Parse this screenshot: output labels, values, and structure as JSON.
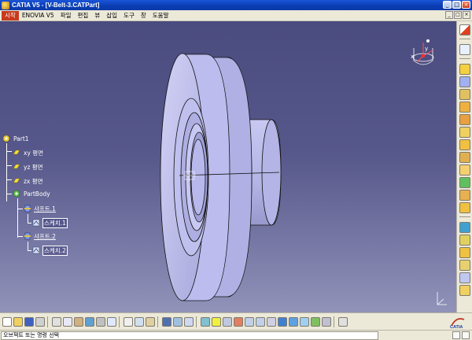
{
  "window": {
    "title": "CATIA V5 - [V-Belt-3.CATPart]",
    "buttons": {
      "minimize": "_",
      "maximize": "□",
      "close": "×"
    }
  },
  "menu": {
    "items": [
      "시작",
      "ENOVIA V5",
      "파일",
      "편집",
      "뷰",
      "삽입",
      "도구",
      "창",
      "도움말"
    ],
    "active": "시작",
    "mdi_buttons": [
      "_",
      "□",
      "×"
    ]
  },
  "tree": {
    "root": "Part1",
    "planes": [
      "xy 평면",
      "yz 평면",
      "zx 평면"
    ],
    "body": "PartBody",
    "features": [
      {
        "label": "샤프트.1",
        "child": "스케치.1"
      },
      {
        "label": "샤프트.2",
        "child": "스케치.2"
      }
    ]
  },
  "compass": {
    "axis_labels": {
      "x": "x",
      "y": "y"
    }
  },
  "status": {
    "prompt": "오브젝트 또는 명령 선택"
  },
  "colors": {
    "viewport_top": "#4a4b7e",
    "viewport_bottom": "#9293b9",
    "part_fill": "#b8b8ea",
    "menu_active": "#c83a1e",
    "titlebar": "#0a3cb2"
  },
  "icons": {
    "right_toolbar": [
      "select-arrow-icon",
      "sketcher-icon",
      "pad-icon",
      "shaft-icon",
      "hole-icon",
      "pocket-icon",
      "groove-icon",
      "fillet-icon",
      "chamfer-icon",
      "draft-icon",
      "shell-icon",
      "thickness-icon",
      "thread-icon",
      "mirror-icon",
      "pattern-icon",
      "scaling-icon",
      "split-icon",
      "sew-icon",
      "close-surface-icon",
      "measure-icon"
    ],
    "bottom_toolbar": [
      "new-icon",
      "open-icon",
      "save-icon",
      "print-icon",
      "cut-icon",
      "copy-icon",
      "paste-icon",
      "undo-icon",
      "redo-icon",
      "help-icon",
      "formula-icon",
      "knowledge-icon",
      "catalog-icon",
      "table-icon",
      "tree-icon",
      "axis-icon",
      "fly-mode-icon",
      "fit-all-icon",
      "pan-icon",
      "rotate-icon",
      "zoom-in-icon",
      "zoom-out-icon",
      "normal-view-icon",
      "iso-view-icon",
      "shading-icon",
      "hide-show-icon",
      "swap-space-icon",
      "3d-compass-icon",
      "catia-logo"
    ]
  }
}
